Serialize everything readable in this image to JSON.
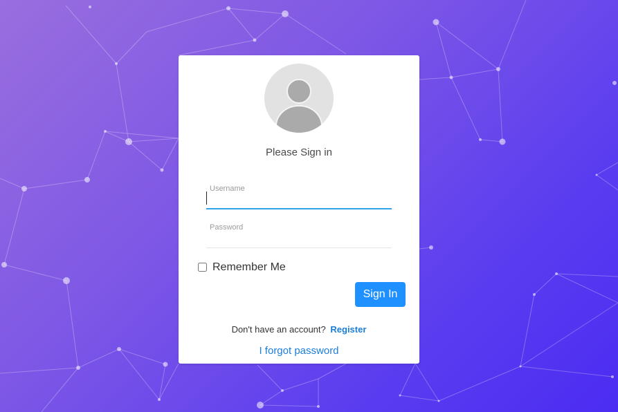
{
  "login": {
    "title": "Please Sign in",
    "username_label": "Username",
    "username_value": "",
    "password_label": "Password",
    "password_value": "",
    "remember_label": "Remember Me",
    "remember_checked": false,
    "signin_label": "Sign In",
    "no_account_text": "Don't have an account?",
    "register_label": "Register",
    "forgot_label": "I forgot password"
  },
  "colors": {
    "primary_button": "#1e90ff",
    "link": "#1a7ed8",
    "active_underline": "#2ea3ea",
    "background_start": "#9a6ede",
    "background_end": "#4b2cf2"
  },
  "icons": {
    "avatar": "user-avatar-icon"
  }
}
